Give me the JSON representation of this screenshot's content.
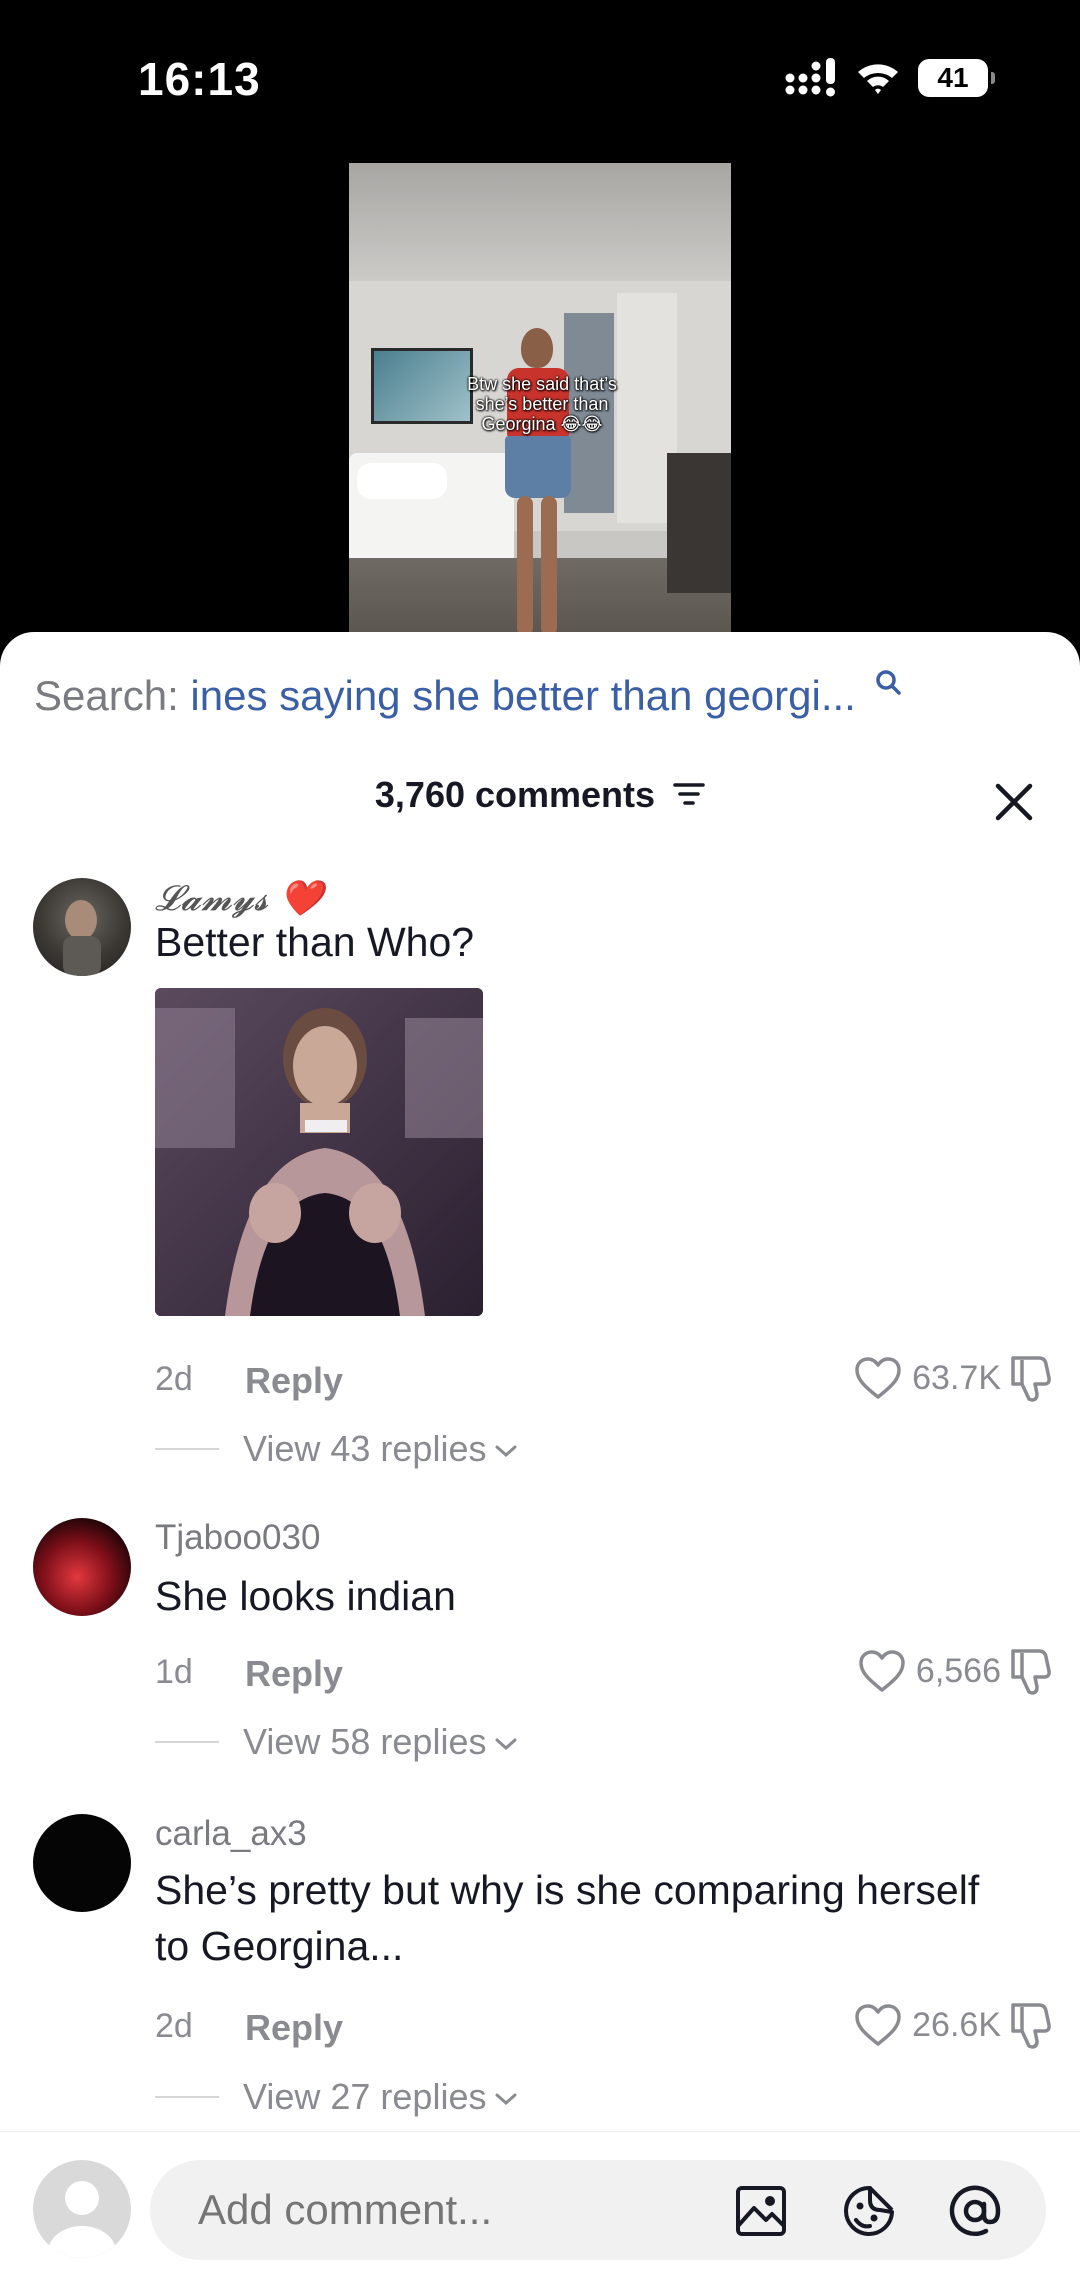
{
  "status_bar": {
    "time": "16:13",
    "battery": "41",
    "icons": [
      "signal-icon",
      "wifi-icon",
      "battery-icon"
    ]
  },
  "video": {
    "caption_lines": [
      "Btw she said that’s",
      "she’s better than",
      "Georgina 😂😂"
    ]
  },
  "search": {
    "prefix": "Search:",
    "query": "ines saying she better than georgi...",
    "icon": "search-icon"
  },
  "header": {
    "comment_count": "3,760 comments",
    "filter_icon": "filter-icon",
    "close_icon": "close-icon"
  },
  "comments": [
    {
      "username": "𝓛𝓪𝓶𝔂𝓼 ❤️",
      "text": "Better than Who?",
      "has_image": true,
      "time": "2d",
      "reply_label": "Reply",
      "likes": "63.7K",
      "view_replies": "View 43 replies"
    },
    {
      "username": "Tjaboo030",
      "text": "She looks indian",
      "has_image": false,
      "time": "1d",
      "reply_label": "Reply",
      "likes": "6,566",
      "view_replies": "View 58 replies"
    },
    {
      "username": "carla_ax3",
      "text": "She’s pretty but why is she comparing herself to Georgina...",
      "has_image": false,
      "time": "2d",
      "reply_label": "Reply",
      "likes": "26.6K",
      "view_replies": "View 27 replies"
    }
  ],
  "composer": {
    "placeholder": "Add comment...",
    "icons": [
      "image-icon",
      "emoji-icon",
      "mention-icon"
    ]
  },
  "colors": {
    "query_blue": "#3b5fa7",
    "muted": "#8a8b91",
    "text": "#161823"
  }
}
